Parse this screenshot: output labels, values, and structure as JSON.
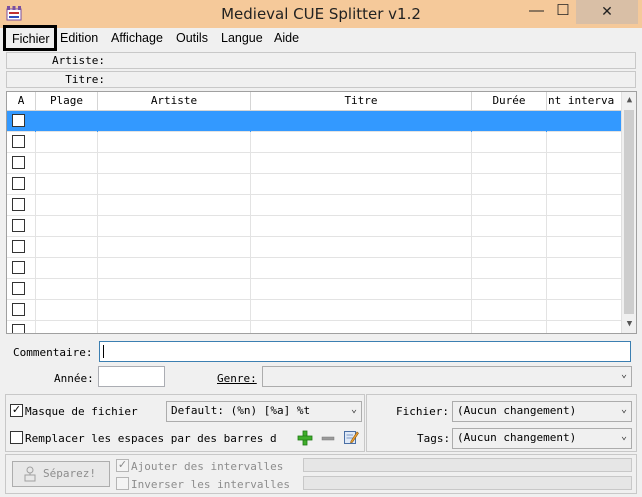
{
  "window": {
    "title": "Medieval CUE Splitter v1.2",
    "minimize_glyph": "—",
    "maximize_glyph": "☐",
    "close_glyph": "✕",
    "colors": {
      "titlebar": "#f5c99a",
      "selection": "#3399ff"
    }
  },
  "menu": {
    "items": [
      "Fichier",
      "Edition",
      "Affichage",
      "Outils",
      "Langue",
      "Aide"
    ]
  },
  "info": {
    "artist_label": "Artiste:",
    "artist_value": "",
    "title_label": "Titre:",
    "title_value": ""
  },
  "table": {
    "columns": [
      "A",
      "Plage",
      "Artiste",
      "Titre",
      "Durée",
      "nt interva"
    ],
    "row_count": 11,
    "selected_row": 0
  },
  "form": {
    "comment_label": "Commentaire:",
    "comment_value": "",
    "year_label": "Année:",
    "year_value": "",
    "genre_label": "Genre:",
    "genre_value": ""
  },
  "options": {
    "mask_label": "Masque de fichier",
    "mask_checked": true,
    "mask_value": "Default: (%n) [%a] %t",
    "replace_label": "Remplacer les espaces par des barres d",
    "replace_checked": false,
    "file_label": "Fichier:",
    "file_value": "(Aucun changement)",
    "tags_label": "Tags:",
    "tags_value": "(Aucun changement)"
  },
  "actions": {
    "split_label": "Séparez!",
    "add_intervals_label": "Ajouter des intervalles",
    "add_intervals_checked": true,
    "invert_intervals_label": "Inverser les intervalles",
    "invert_intervals_checked": false
  },
  "icons": {
    "app": "medieval-app-icon",
    "add": "plus-icon",
    "remove": "minus-icon",
    "edit": "edit-icon",
    "split": "split-icon"
  }
}
